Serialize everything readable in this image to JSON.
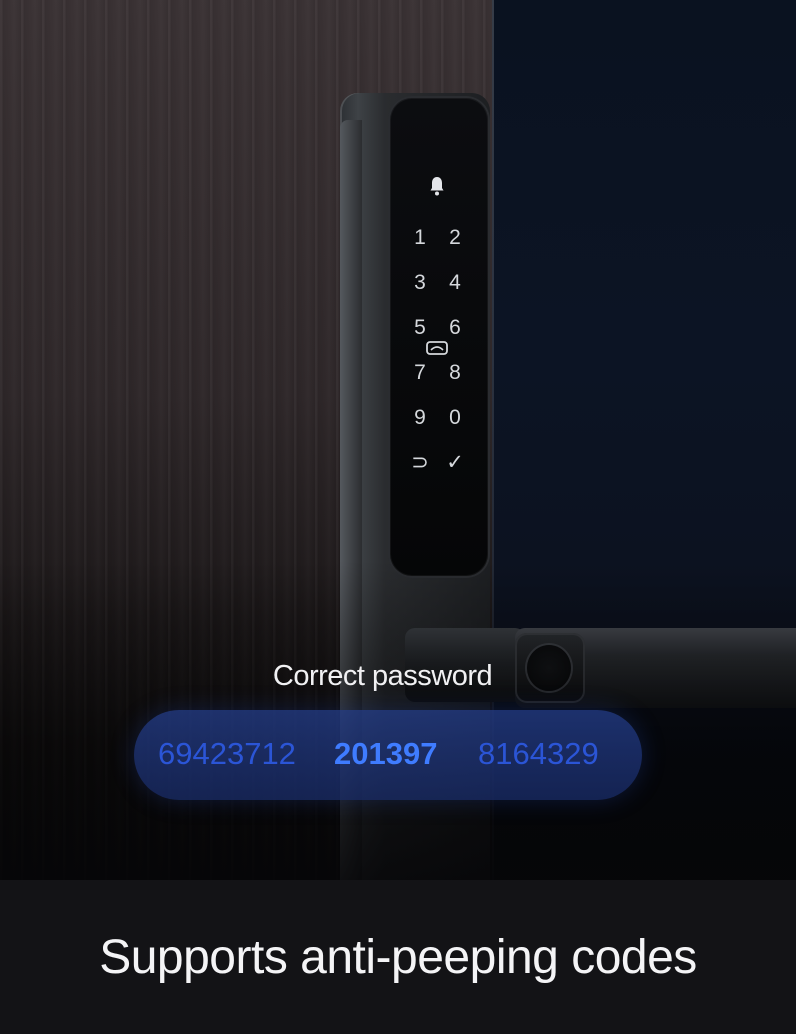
{
  "keypad": {
    "keys": [
      "1",
      "2",
      "3",
      "4",
      "5",
      "6",
      "7",
      "8",
      "9",
      "0",
      "⊃",
      "✓"
    ]
  },
  "overlay": {
    "label": "Correct password",
    "codes": {
      "left": "69423712",
      "center": "201397",
      "right": "8164329"
    }
  },
  "caption": "Supports anti-peeping codes",
  "colors": {
    "code_highlight": "#3f7cff",
    "code_dim": "#2b55d6",
    "pill_background": "#243e8c"
  },
  "icons": [
    "bell-icon",
    "sensor-icon",
    "fingerprint-reader"
  ]
}
